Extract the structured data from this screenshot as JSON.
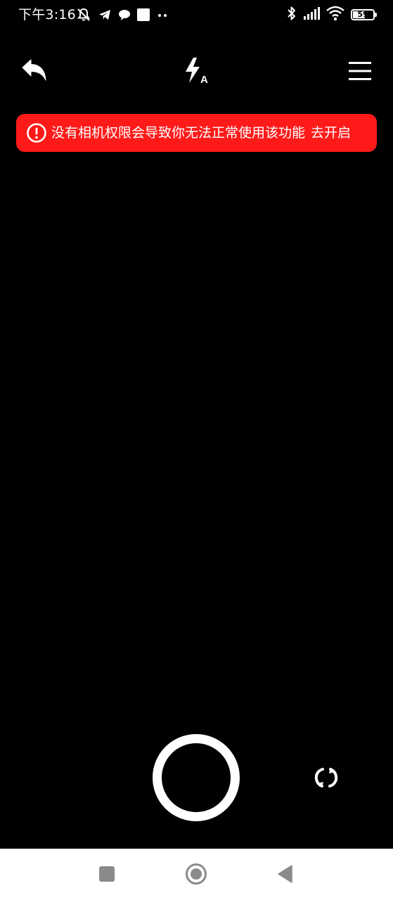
{
  "status_bar": {
    "time": "下午3:16",
    "battery_level": "59",
    "icons": [
      "mute-bell-icon",
      "telegram-icon",
      "chat-bubble-icon",
      "square-notification-icon",
      "more-dots-icon",
      "bluetooth-icon",
      "signal-icon",
      "wifi-icon",
      "battery-icon"
    ]
  },
  "toolbar": {
    "back_icon": "reply-arrow-icon",
    "flash_icon": "flash-auto-icon",
    "menu_icon": "hamburger-menu-icon"
  },
  "warning": {
    "message": "没有相机权限会导致你无法正常使用该功能",
    "action": "去开启",
    "background_color": "#ff1a1a"
  },
  "camera": {
    "shutter_icon": "shutter-ring",
    "switch_icon": "switch-camera-icon"
  },
  "nav_bar": {
    "items": [
      "recents-square-icon",
      "home-circle-icon",
      "back-triangle-icon"
    ]
  }
}
